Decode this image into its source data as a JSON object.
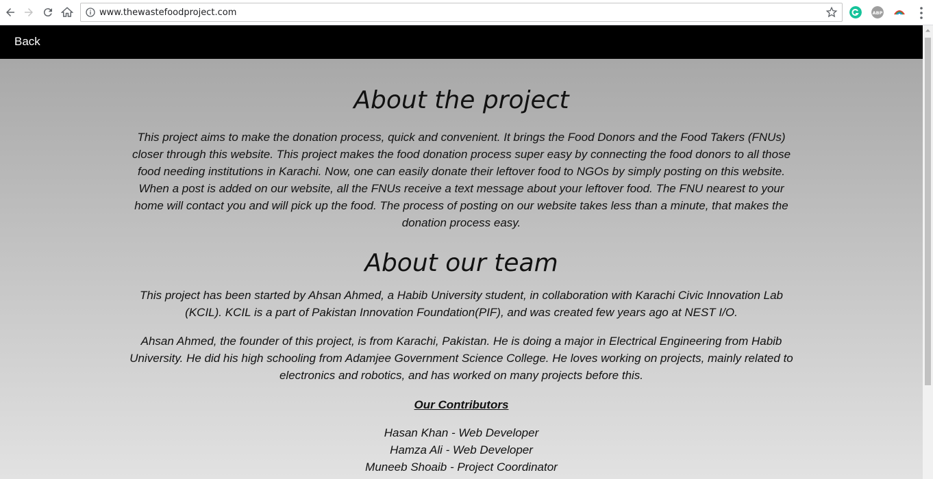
{
  "browser": {
    "url": "www.thewastefoodproject.com",
    "icons": [
      "back-arrow-icon",
      "forward-arrow-icon",
      "reload-icon",
      "home-icon",
      "info-icon",
      "star-icon",
      "grammarly-icon",
      "adblock-icon",
      "extension-icon",
      "menu-icon"
    ],
    "extensions": {
      "grammarly_color": "#15c39a",
      "abp_color": "#9e9e9e"
    }
  },
  "header": {
    "back_label": "Back",
    "background": "#000000"
  },
  "about_project": {
    "title": "About the project",
    "text": "This project aims to make the donation process, quick and convenient. It brings the Food Donors and the Food Takers (FNUs) closer through this website. This project makes the food donation process super easy by connecting the food donors to all those food needing institutions in Karachi. Now, one can easily donate their leftover food to NGOs by simply posting on this website. When a post is added on our website, all the FNUs receive a text message about your leftover food. The FNU nearest to your home will contact you and will pick up the food. The process of posting on our website takes less than a minute, that makes the donation process easy."
  },
  "about_team": {
    "title": "About our team",
    "para1": "This project has been started by Ahsan Ahmed, a Habib University student, in collaboration with Karachi Civic Innovation Lab (KCIL). KCIL is a part of Pakistan Innovation Foundation(PIF), and was created few years ago at NEST I/O.",
    "para2": "Ahsan Ahmed, the founder of this project, is from Karachi, Pakistan. He is doing a major in Electrical Engineering from Habib University. He did his high schooling from Adamjee Government Science College. He loves working on projects, mainly related to electronics and robotics, and has worked on many projects before this."
  },
  "contributors": {
    "heading": "Our Contributors",
    "list": [
      "Hasan Khan - Web Developer",
      "Hamza Ali - Web Developer",
      "Muneeb Shoaib - Project Coordinator"
    ]
  }
}
